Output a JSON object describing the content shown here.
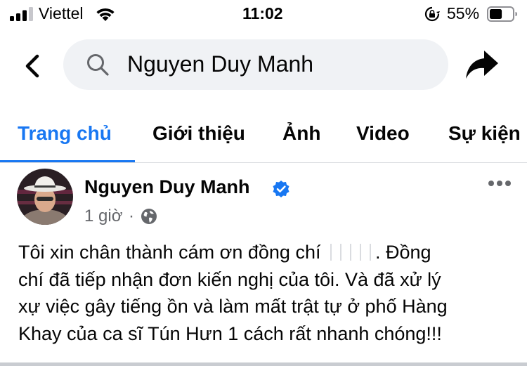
{
  "status_bar": {
    "carrier": "Viettel",
    "time": "11:02",
    "battery_percent": "55%",
    "battery_level": 0.55,
    "icons": [
      "signal-icon",
      "wifi-icon",
      "rotation-lock-icon",
      "battery-icon"
    ]
  },
  "header": {
    "back_icon": "chevron-left-icon",
    "search_text": "Nguyen Duy Manh",
    "share_icon": "share-arrow-icon"
  },
  "tabs": [
    {
      "label": "Trang chủ",
      "active": true
    },
    {
      "label": "Giới thiệu",
      "active": false
    },
    {
      "label": "Ảnh",
      "active": false
    },
    {
      "label": "Video",
      "active": false
    },
    {
      "label": "Sự kiện",
      "active": false
    }
  ],
  "post": {
    "author": "Nguyen Duy Manh",
    "verified": true,
    "time": "1 giờ",
    "separator": "·",
    "privacy_icon": "globe-icon",
    "more_icon": "more-horizontal-icon",
    "lines": [
      {
        "before": "Tôi xin chân thành cám ơn đồng chí",
        "after": ". Đồng"
      },
      {
        "text": "chí đã tiếp nhận đơn kiến nghị của tôi. Và đã xử lý"
      },
      {
        "text": "xự việc gây tiếng ồn và làm mất trật tự ở phố Hàng"
      },
      {
        "text": "Khay của ca sĩ Tún Hưn 1 cách rất nhanh chóng!!!"
      }
    ]
  },
  "colors": {
    "accent": "#1877f2",
    "search_bg": "#f0f2f5",
    "secondary_text": "#65676b",
    "verified": "#1877f2"
  }
}
